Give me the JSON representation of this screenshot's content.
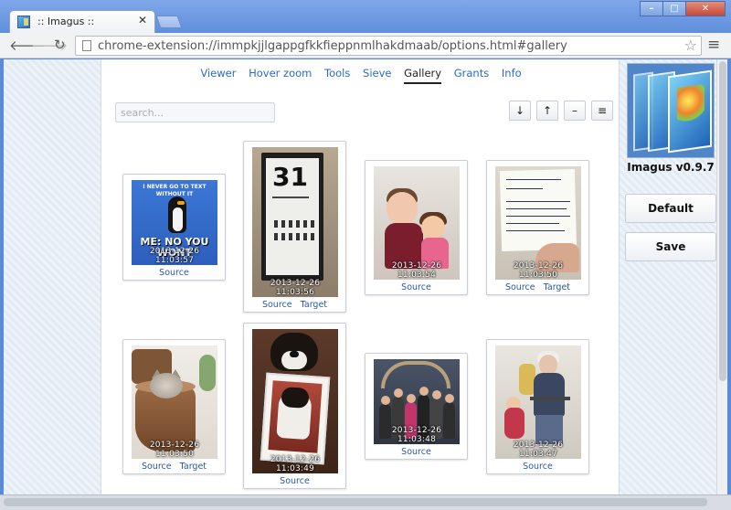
{
  "window": {
    "tab_title": ":: Imagus ::",
    "tab_close": "✕",
    "controls": [
      "–",
      "□",
      "✕"
    ]
  },
  "toolbar": {
    "url": "chrome-extension://immpkjjlgappgfkkfieppnmlhakdmaab/options.html#gallery",
    "back_icon": "arrow-left-icon",
    "forward_icon": "arrow-right-icon",
    "reload_icon": "reload-icon",
    "star_icon": "star-icon",
    "menu_icon": "hamburger-menu-icon"
  },
  "nav": {
    "items": [
      "Viewer",
      "Hover zoom",
      "Tools",
      "Sieve",
      "Gallery",
      "Grants",
      "Info"
    ],
    "active": "Gallery"
  },
  "search": {
    "placeholder": "search..."
  },
  "controls": [
    "↓",
    "↑",
    "–",
    "≡"
  ],
  "gallery": [
    {
      "timestamp": "2013-12-26 11:03:57",
      "links": [
        "Source"
      ],
      "caption_top": "I NEVER GO TO TEXT WITHOUT IT",
      "caption_bottom": "ME: NO YOU WONT"
    },
    {
      "timestamp": "2013-12-26 11:03:56",
      "links": [
        "Source",
        "Target"
      ],
      "sign_number": "31"
    },
    {
      "timestamp": "2013-12-26 11:03:54",
      "links": [
        "Source"
      ]
    },
    {
      "timestamp": "2013-12-26 11:03:50",
      "links": [
        "Source",
        "Target"
      ]
    },
    {
      "timestamp": "2013-12-26 11:03:50",
      "links": [
        "Source",
        "Target"
      ]
    },
    {
      "timestamp": "2013-12-26 11:03:49",
      "links": [
        "Source"
      ]
    },
    {
      "timestamp": "2013-12-26 11:03:48",
      "links": [
        "Source"
      ]
    },
    {
      "timestamp": "2013-12-26 11:03:47",
      "links": [
        "Source"
      ]
    }
  ],
  "side": {
    "version": "Imagus v0.9.7",
    "default_label": "Default",
    "save_label": "Save"
  },
  "colors": {
    "link": "#2b6bc2",
    "titlebar": "#6f9ae2"
  }
}
